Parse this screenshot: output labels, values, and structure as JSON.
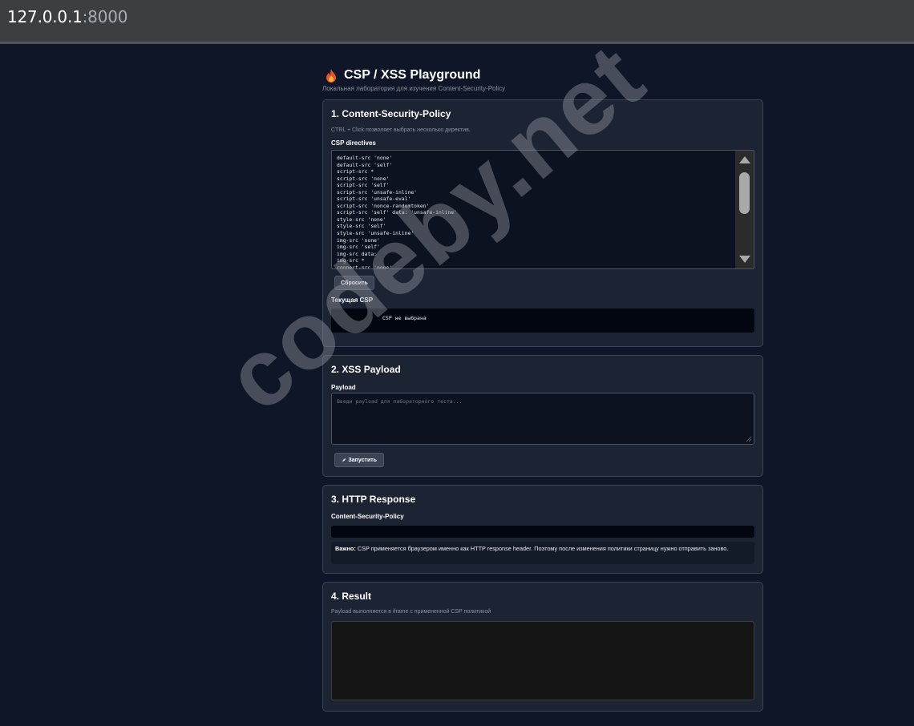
{
  "browser": {
    "host": "127.0.0.1",
    "port": ":8000"
  },
  "header": {
    "title": "CSP / XSS Playground",
    "subtitle": "Локальная лаборатория для изучения Content-Security-Policy",
    "icon": "fire-icon"
  },
  "csp_section": {
    "title": "1. Content-Security-Policy",
    "hint": "CTRL + Click позволяет выбрать несколько директив.",
    "directives_label": "CSP directives",
    "directives": [
      "default-src 'none'",
      "default-src 'self'",
      "script-src *",
      "script-src 'none'",
      "script-src 'self'",
      "script-src 'unsafe-inline'",
      "script-src 'unsafe-eval'",
      "script-src 'nonce-randomtoken'",
      "script-src 'self' data: 'unsafe-inline'",
      "style-src 'none'",
      "style-src 'self'",
      "style-src 'unsafe-inline'",
      "img-src 'none'",
      "img-src 'self'",
      "img-src data:",
      "img-src *",
      "connect-src 'none'"
    ],
    "reset_label": "Сбросить",
    "current_label": "Текущая CSP",
    "current_value": "CSP не выбрана"
  },
  "payload_section": {
    "title": "2. XSS Payload",
    "payload_label": "Payload",
    "placeholder": "Введи payload для лабораторного теста...",
    "run_label": "Запустить"
  },
  "response_section": {
    "title": "3. HTTP Response",
    "header_label": "Content-Security-Policy",
    "header_value": "",
    "note_bold": "Важно:",
    "note_text": " CSP применяется браузером именно как HTTP response header. Поэтому после изменения политики страницу нужно отправить заново."
  },
  "result_section": {
    "title": "4. Result",
    "hint": "Payload выполняется в iframe с примененной CSP политикой"
  },
  "watermark": "codeby.net",
  "colors": {
    "page_bg": "#0f1627",
    "card_bg": "#1c2433",
    "card_border": "#3a4456",
    "code_bg": "#02060f",
    "button_bg": "#3b4454"
  }
}
